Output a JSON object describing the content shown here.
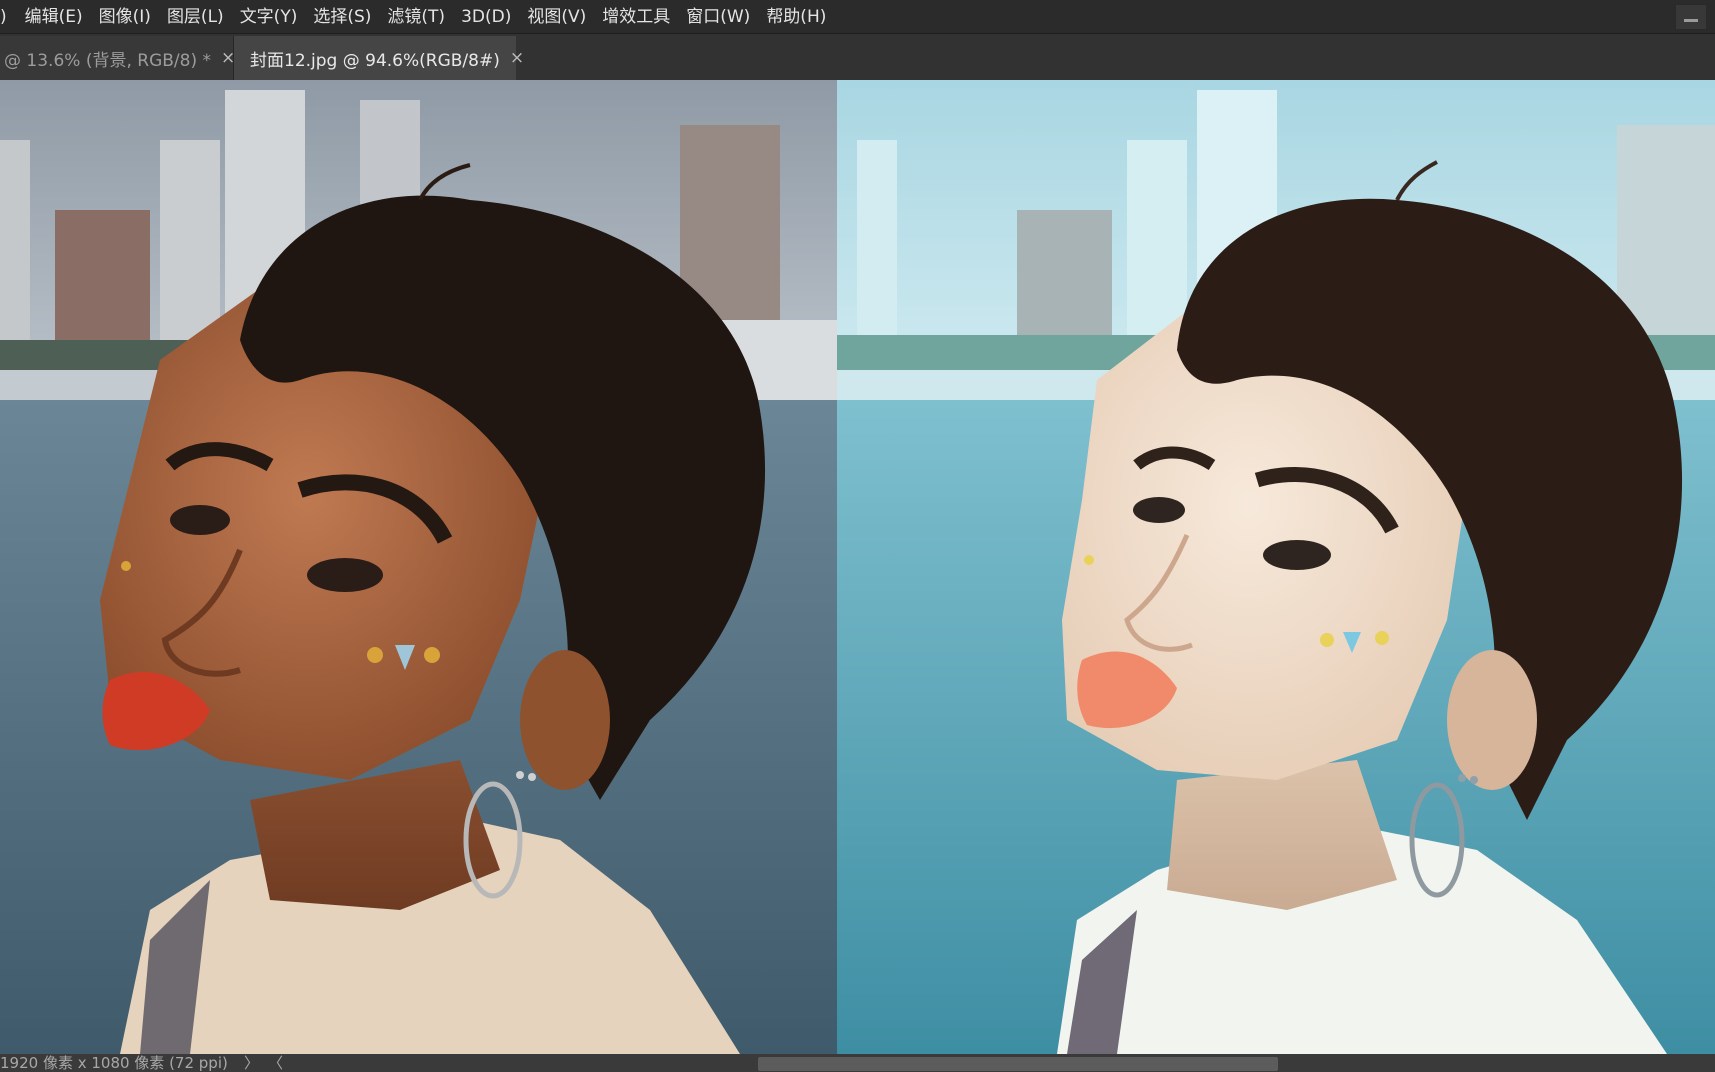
{
  "menubar": {
    "items": [
      ")",
      "编辑(E)",
      "图像(I)",
      "图层(L)",
      "文字(Y)",
      "选择(S)",
      "滤镜(T)",
      "3D(D)",
      "视图(V)",
      "增效工具",
      "窗口(W)",
      "帮助(H)"
    ]
  },
  "tabs": [
    {
      "label": "@ 13.6% (背景, RGB/8) *",
      "close": "×",
      "active": false
    },
    {
      "label": "封面12.jpg @ 94.6%(RGB/8#)",
      "close": "×",
      "active": true
    }
  ],
  "status": {
    "doc_info": "1920 像素 x 1080 像素 (72 ppi)",
    "arrow_right": "〉",
    "arrow_left": "〈"
  },
  "colors": {
    "menubar_bg": "#2b2b2b",
    "tabbar_bg": "#323232",
    "active_tab_bg": "#454545",
    "before_water": "#58788a",
    "after_water": "#5da4b6"
  }
}
